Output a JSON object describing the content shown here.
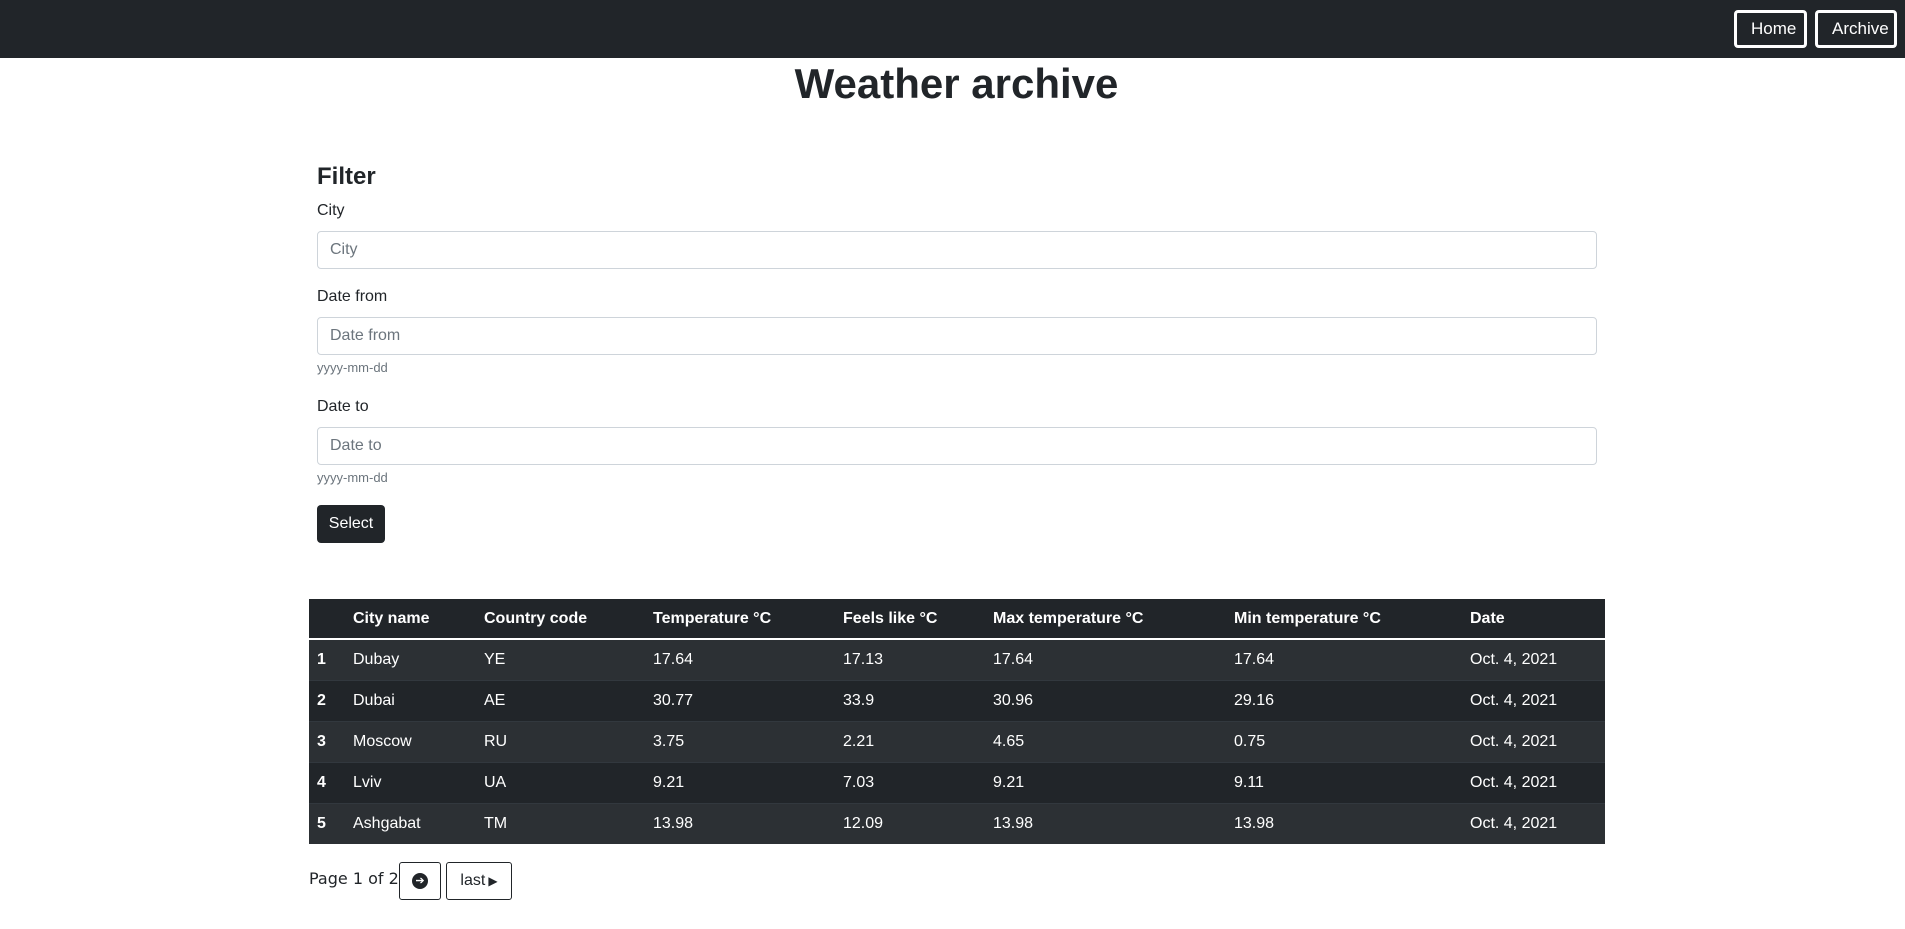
{
  "nav": {
    "home_label": "Home",
    "archive_label": "Archive"
  },
  "page": {
    "title": "Weather archive"
  },
  "filter": {
    "title": "Filter",
    "city_label": "City",
    "city_placeholder": "City",
    "date_from_label": "Date from",
    "date_from_placeholder": "Date from",
    "date_from_hint": "yyyy-mm-dd",
    "date_to_label": "Date to",
    "date_to_placeholder": "Date to",
    "date_to_hint": "yyyy-mm-dd",
    "select_label": "Select"
  },
  "table": {
    "headers": [
      "",
      "City name",
      "Country code",
      "Temperature °C",
      "Feels like °C",
      "Max temperature °C",
      "Min temperature °C",
      "Date"
    ],
    "rows": [
      [
        "1",
        "Dubay",
        "YE",
        "17.64",
        "17.13",
        "17.64",
        "17.64",
        "Oct. 4, 2021"
      ],
      [
        "2",
        "Dubai",
        "AE",
        "30.77",
        "33.9",
        "30.96",
        "29.16",
        "Oct. 4, 2021"
      ],
      [
        "3",
        "Moscow",
        "RU",
        "3.75",
        "2.21",
        "4.65",
        "0.75",
        "Oct. 4, 2021"
      ],
      [
        "4",
        "Lviv",
        "UA",
        "9.21",
        "7.03",
        "9.21",
        "9.11",
        "Oct. 4, 2021"
      ],
      [
        "5",
        "Ashgabat",
        "TM",
        "13.98",
        "12.09",
        "13.98",
        "13.98",
        "Oct. 4, 2021"
      ]
    ]
  },
  "pagination": {
    "text": "Page 1 of 2.",
    "next_icon": "arrow-right-circle-icon",
    "last_label": "last",
    "last_icon": "caret-right-icon"
  }
}
